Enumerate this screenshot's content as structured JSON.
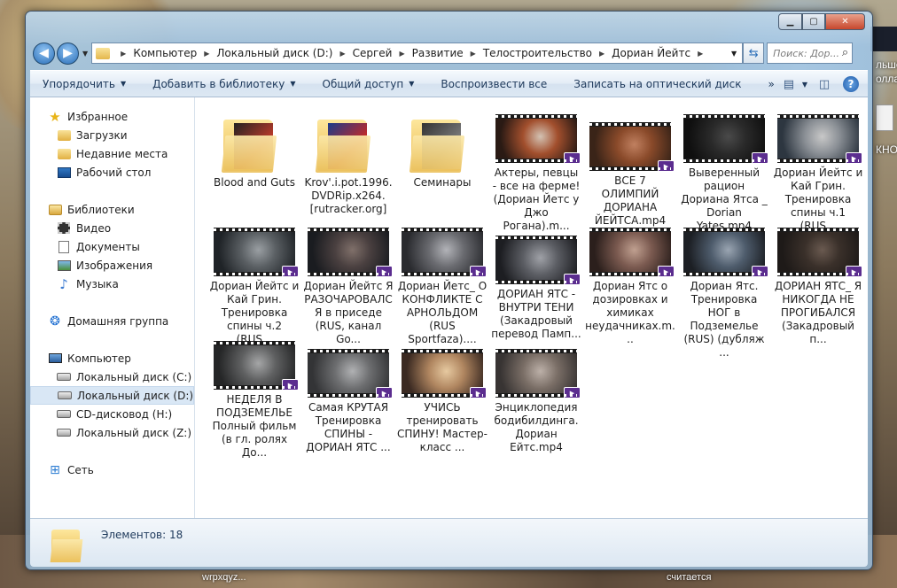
{
  "desktop": {
    "text_right_1": "льше",
    "text_right_2": "олла",
    "text_right_3": "КНО",
    "text_bottom_1": "wrpxqyz...",
    "text_bottom_2": "считается"
  },
  "window": {
    "caption": {
      "minimize": "▁",
      "maximize": "▢",
      "close": "✕"
    }
  },
  "address": {
    "crumbs": [
      "Компьютер",
      "Локальный диск (D:)",
      "Сергей",
      "Развитие",
      "Телостроительство",
      "Дориан Йейтс"
    ],
    "search_placeholder": "Поиск: Дор..."
  },
  "toolbar": {
    "organize": "Упорядочить",
    "add_library": "Добавить в библиотеку",
    "share": "Общий доступ",
    "play_all": "Воспроизвести все",
    "burn": "Записать на оптический диск",
    "more": "»"
  },
  "nav": {
    "favorites": "Избранное",
    "downloads": "Загрузки",
    "recent": "Недавние места",
    "desktop": "Рабочий стол",
    "libraries": "Библиотеки",
    "video": "Видео",
    "documents": "Документы",
    "pictures": "Изображения",
    "music": "Музыка",
    "homegroup": "Домашняя группа",
    "computer": "Компьютер",
    "drive_c": "Локальный диск (C:)",
    "drive_d": "Локальный диск (D:)",
    "drive_h": "CD-дисковод (H:)",
    "drive_z": "Локальный диск (Z:)",
    "network": "Сеть"
  },
  "files": [
    {
      "name": "Blood and Guts",
      "type": "folder"
    },
    {
      "name": "Krov'.i.pot.1996.DVDRip.x264.[rutracker.org]",
      "type": "folder"
    },
    {
      "name": "Семинары",
      "type": "folder"
    },
    {
      "name": "Актеры, певцы - все на ферме! (Дориан Йетс у Джо Рогана).m...",
      "type": "video"
    },
    {
      "name": "ВСЕ 7 ОЛИМПИЙ ДОРИАНА ЙЕЙТСА.mp4",
      "type": "video"
    },
    {
      "name": "Выверенный рацион Дориана Ятса _ Dorian Yates.mp4",
      "type": "video"
    },
    {
      "name": "Дориан Йейтс и Кай Грин. Тренировка спины ч.1 (RUS...",
      "type": "video"
    },
    {
      "name": "Дориан Йейтс и Кай Грин. Тренировка спины ч.2 (RUS...",
      "type": "video"
    },
    {
      "name": "Дориан Йейтс Я РАЗОЧАРОВАЛСЯ в приседе (RUS, канал Go...",
      "type": "video"
    },
    {
      "name": "Дориан Йетс_ О КОНФЛИКТЕ С АРНОЛЬДОМ (RUS Sportfaza)....",
      "type": "video"
    },
    {
      "name": "ДОРИАН ЯТС - ВНУТРИ ТЕНИ (Закадровый перевод Памп...",
      "type": "video"
    },
    {
      "name": "Дориан Ятс о дозировках и химиках неудачниках.m...",
      "type": "video"
    },
    {
      "name": "Дориан Ятс. Тренировка НОГ в Подземелье (RUS) (дубляж ...",
      "type": "video"
    },
    {
      "name": "ДОРИАН ЯТС_ Я НИКОГДА НЕ ПРОГИБАЛСЯ (Закадровый п...",
      "type": "video"
    },
    {
      "name": "НЕДЕЛЯ В ПОДЗЕМЕЛЬЕ Полный фильм (в гл. ролях До...",
      "type": "video"
    },
    {
      "name": "Самая КРУТАЯ Тренировка СПИНЫ - ДОРИАН ЯТС ...",
      "type": "video"
    },
    {
      "name": "УЧИСЬ тренировать СПИНУ! Мастер-класс ...",
      "type": "video"
    },
    {
      "name": "Энциклопедия бодибилдинга. Дориан Ейтс.mp4",
      "type": "video"
    }
  ],
  "status": {
    "count": "Элементов: 18"
  },
  "colors": {
    "accent": "#1e395b",
    "selection": "#d9e7f5",
    "badge": "#5b2d8f"
  }
}
